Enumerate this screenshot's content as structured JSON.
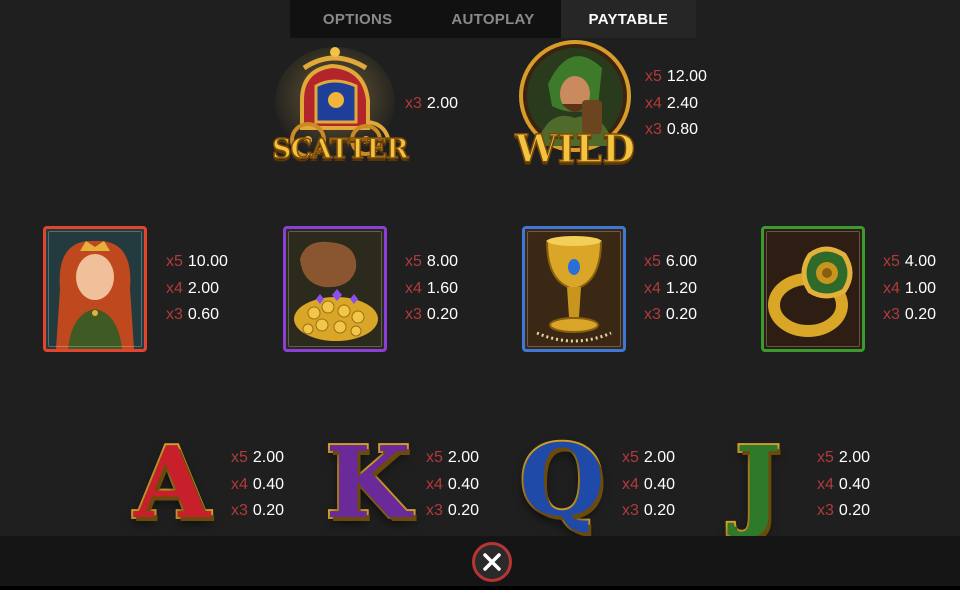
{
  "tabs": [
    {
      "label": "OPTIONS"
    },
    {
      "label": "AUTOPLAY"
    },
    {
      "label": "PAYTABLE"
    }
  ],
  "active_tab": "PAYTABLE",
  "scatter": {
    "label": "SCATTER",
    "pays": [
      {
        "mult": "x3",
        "value": "2.00"
      }
    ]
  },
  "wild": {
    "label": "WILD",
    "pays": [
      {
        "mult": "x5",
        "value": "12.00"
      },
      {
        "mult": "x4",
        "value": "2.40"
      },
      {
        "mult": "x3",
        "value": "0.80"
      }
    ]
  },
  "premium": [
    {
      "name": "lady",
      "frame_color": "#e2452d",
      "pays": [
        {
          "mult": "x5",
          "value": "10.00"
        },
        {
          "mult": "x4",
          "value": "2.00"
        },
        {
          "mult": "x3",
          "value": "0.60"
        }
      ]
    },
    {
      "name": "coin-bag",
      "frame_color": "#8a3fd6",
      "pays": [
        {
          "mult": "x5",
          "value": "8.00"
        },
        {
          "mult": "x4",
          "value": "1.60"
        },
        {
          "mult": "x3",
          "value": "0.20"
        }
      ]
    },
    {
      "name": "goblet",
      "frame_color": "#3f77d6",
      "pays": [
        {
          "mult": "x5",
          "value": "6.00"
        },
        {
          "mult": "x4",
          "value": "1.20"
        },
        {
          "mult": "x3",
          "value": "0.20"
        }
      ]
    },
    {
      "name": "ring",
      "frame_color": "#3b9a2c",
      "pays": [
        {
          "mult": "x5",
          "value": "4.00"
        },
        {
          "mult": "x4",
          "value": "1.00"
        },
        {
          "mult": "x3",
          "value": "0.20"
        }
      ]
    }
  ],
  "letters": [
    {
      "char": "A",
      "color": "#c8202a",
      "pays": [
        {
          "mult": "x5",
          "value": "2.00"
        },
        {
          "mult": "x4",
          "value": "0.40"
        },
        {
          "mult": "x3",
          "value": "0.20"
        }
      ]
    },
    {
      "char": "K",
      "color": "#6a2a9a",
      "pays": [
        {
          "mult": "x5",
          "value": "2.00"
        },
        {
          "mult": "x4",
          "value": "0.40"
        },
        {
          "mult": "x3",
          "value": "0.20"
        }
      ]
    },
    {
      "char": "Q",
      "color": "#1f4aa8",
      "pays": [
        {
          "mult": "x5",
          "value": "2.00"
        },
        {
          "mult": "x4",
          "value": "0.40"
        },
        {
          "mult": "x3",
          "value": "0.20"
        }
      ]
    },
    {
      "char": "J",
      "color": "#2e7a2a",
      "pays": [
        {
          "mult": "x5",
          "value": "2.00"
        },
        {
          "mult": "x4",
          "value": "0.40"
        },
        {
          "mult": "x3",
          "value": "0.20"
        }
      ]
    }
  ],
  "colors": {
    "background": "#1f1f1f",
    "multiplier": "#b23a3a",
    "close_ring": "#b73535"
  },
  "close_icon": "close-icon"
}
